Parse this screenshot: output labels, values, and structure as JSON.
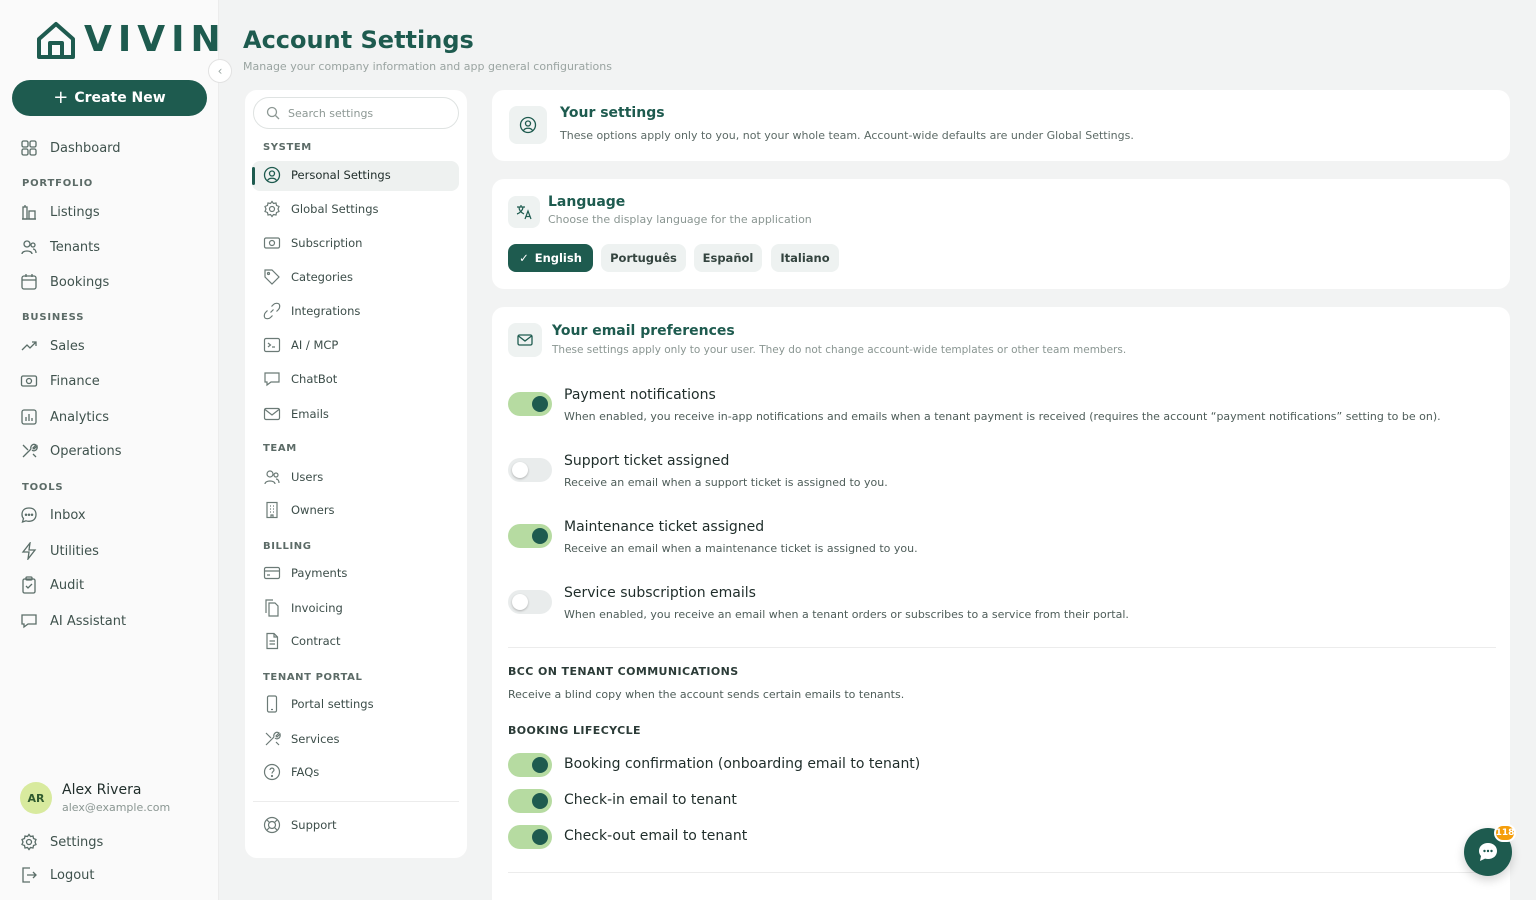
{
  "brand": {
    "name": "VIVIN",
    "color": "#1e5b4f"
  },
  "sidebar": {
    "create_label": "Create New",
    "dashboard": "Dashboard",
    "sections": {
      "portfolio": "PORTFOLIO",
      "business": "BUSINESS",
      "tools": "TOOLS"
    },
    "items": {
      "listings": "Listings",
      "tenants": "Tenants",
      "bookings": "Bookings",
      "sales": "Sales",
      "finance": "Finance",
      "analytics": "Analytics",
      "operations": "Operations",
      "inbox": "Inbox",
      "utilities": "Utilities",
      "audit": "Audit",
      "ai_assistant": "AI Assistant"
    },
    "user": {
      "initials": "AR",
      "name": "Alex Rivera",
      "email": "alex@example.com"
    },
    "settings": "Settings",
    "logout": "Logout"
  },
  "header": {
    "title": "Account Settings",
    "subtitle": "Manage your company information and app general configurations"
  },
  "settings_nav": {
    "search_placeholder": "Search settings",
    "sections": {
      "system": "SYSTEM",
      "team": "TEAM",
      "billing": "BILLING",
      "tenant_portal": "TENANT PORTAL"
    },
    "items": {
      "personal": "Personal Settings",
      "global": "Global Settings",
      "subscription": "Subscription",
      "categories": "Categories",
      "integrations": "Integrations",
      "ai_mcp": "AI / MCP",
      "chatbot": "ChatBot",
      "emails": "Emails",
      "users": "Users",
      "owners": "Owners",
      "payments": "Payments",
      "invoicing": "Invoicing",
      "contract": "Contract",
      "portal_settings": "Portal settings",
      "services": "Services",
      "faqs": "FAQs",
      "support": "Support"
    },
    "active": "personal"
  },
  "your_settings": {
    "title": "Your settings",
    "desc": "These options apply only to you, not your whole team. Account-wide defaults are under Global Settings."
  },
  "language": {
    "title": "Language",
    "desc": "Choose the display language for the application",
    "options": [
      "English",
      "Português",
      "Español",
      "Italiano"
    ],
    "selected": "English"
  },
  "email_prefs": {
    "title": "Your email preferences",
    "desc": "These settings apply only to your user. They do not change account-wide templates or other team members.",
    "items": [
      {
        "title": "Payment notifications",
        "desc": "When enabled, you receive in-app notifications and emails when a tenant payment is received (requires the account “payment notifications” setting to be on).",
        "on": true
      },
      {
        "title": "Support ticket assigned",
        "desc": "Receive an email when a support ticket is assigned to you.",
        "on": false
      },
      {
        "title": "Maintenance ticket assigned",
        "desc": "Receive an email when a maintenance ticket is assigned to you.",
        "on": true
      },
      {
        "title": "Service subscription emails",
        "desc": "When enabled, you receive an email when a tenant orders or subscribes to a service from their portal.",
        "on": false
      }
    ],
    "bcc": {
      "title": "BCC ON TENANT COMMUNICATIONS",
      "desc": "Receive a blind copy when the account sends certain emails to tenants."
    },
    "booking": {
      "title": "BOOKING LIFECYCLE",
      "items": [
        {
          "title": "Booking confirmation (onboarding email to tenant)",
          "on": true
        },
        {
          "title": "Check-in email to tenant",
          "on": true
        },
        {
          "title": "Check-out email to tenant",
          "on": true
        }
      ]
    }
  },
  "chat": {
    "badge": "118"
  }
}
